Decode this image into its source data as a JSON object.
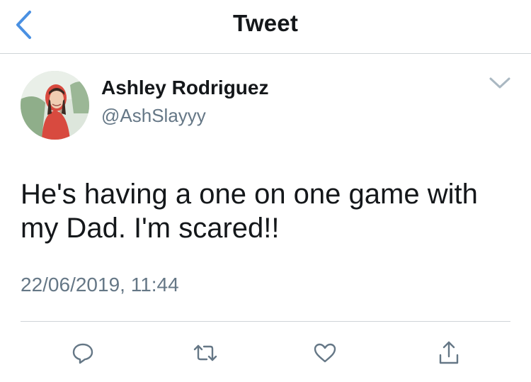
{
  "nav": {
    "title": "Tweet",
    "back_icon": "chevron-left-icon",
    "accent_color": "#4a90e2"
  },
  "tweet": {
    "author_name": "Ashley Rodriguez",
    "author_handle": "@AshSlayyy",
    "text": "He's having a one on one game with my Dad. I'm scared!!",
    "timestamp": "22/06/2019, 11:44",
    "menu_icon": "chevron-down-icon"
  },
  "actions": [
    {
      "icon": "reply-icon"
    },
    {
      "icon": "retweet-icon"
    },
    {
      "icon": "like-icon"
    },
    {
      "icon": "share-icon"
    }
  ],
  "colors": {
    "text_primary": "#14171a",
    "text_secondary": "#657786",
    "divider": "#cfd4d8",
    "icon_gray": "#657786"
  }
}
